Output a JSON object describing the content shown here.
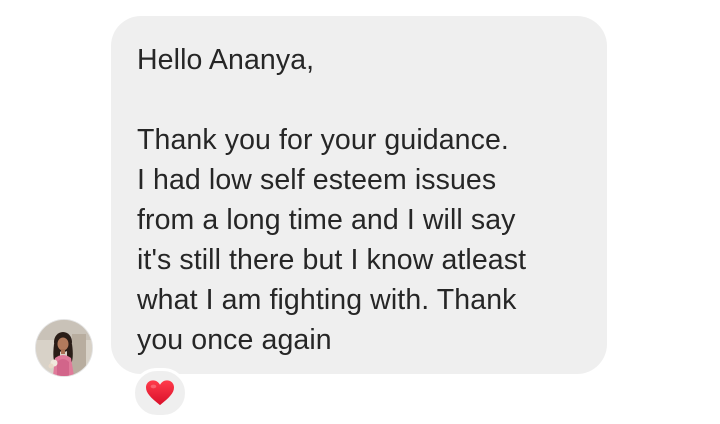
{
  "message": {
    "text": "Hello Ananya,\n\nThank you for your guidance.\nI had low self esteem issues\nfrom a long time and I will say\nit's still there but I know atleast\nwhat I am fighting with. Thank\nyou once again",
    "reaction_icon": "heart-icon",
    "bubble_color": "#efefef",
    "text_color": "#262626",
    "reaction_color": "#ed1c2e"
  },
  "sender": {
    "avatar_icon": "profile-photo"
  }
}
